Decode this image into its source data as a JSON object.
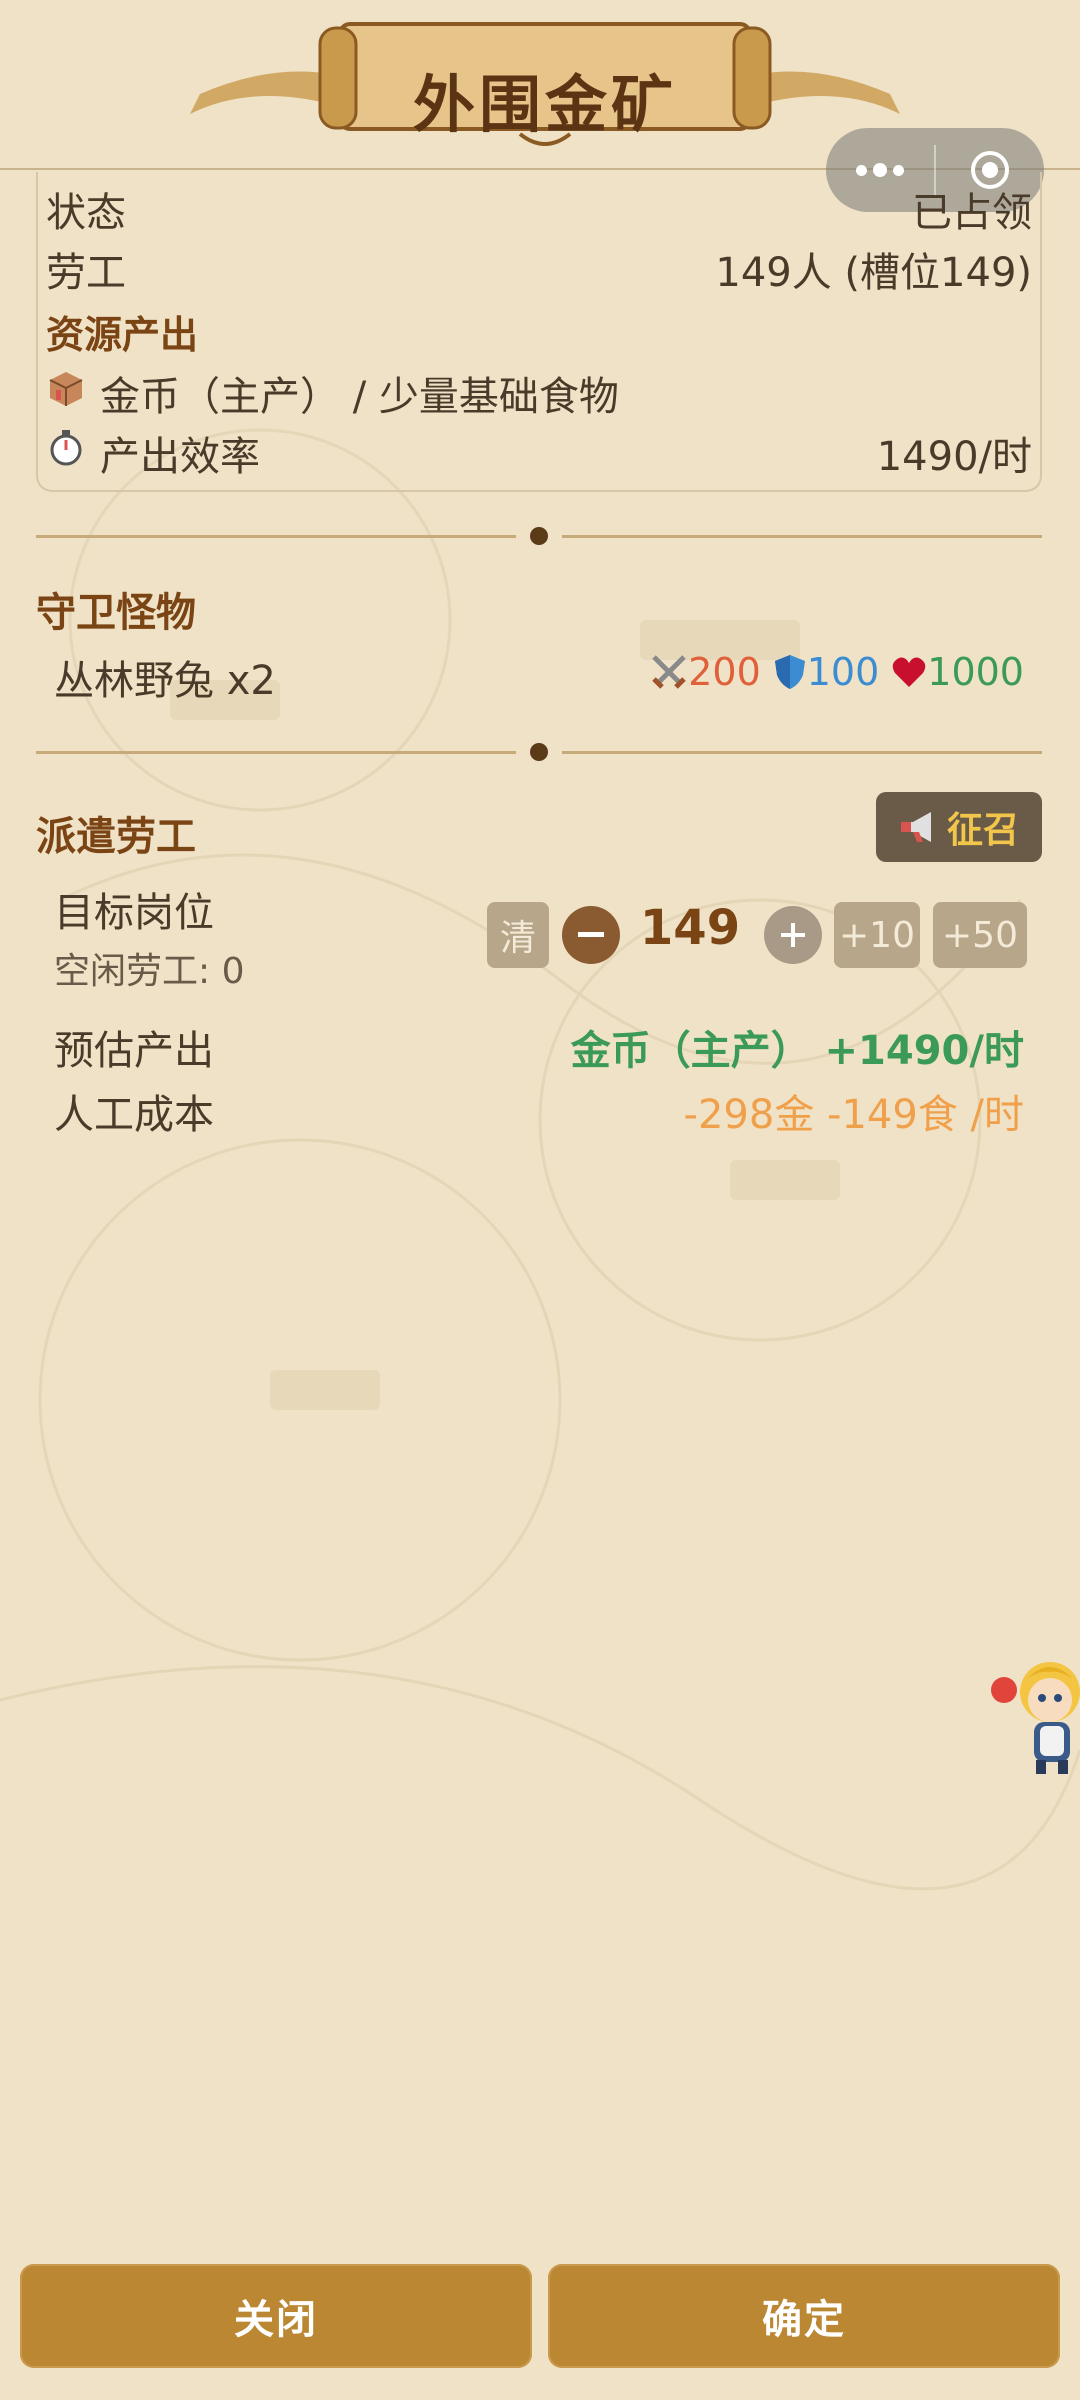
{
  "title": "外围金矿",
  "info": {
    "status_label": "状态",
    "status_value": "已占领",
    "workers_label": "劳工",
    "workers_value": "149人 (槽位149)",
    "resource_title": "资源产出",
    "resource_desc": "金币（主产） / 少量基础食物",
    "efficiency_label": "产出效率",
    "efficiency_value": "1490/时"
  },
  "guard": {
    "title": "守卫怪物",
    "monster": "丛林野兔 x2",
    "attack": "200",
    "defense": "100",
    "hp": "1000"
  },
  "dispatch": {
    "title": "派遣劳工",
    "recruit_label": "征召",
    "target_label": "目标岗位",
    "idle_label": "空闲劳工: 0",
    "clear_label": "清",
    "count": "149",
    "plus10": "+10",
    "plus50": "+50",
    "estimate_label": "预估产出",
    "estimate_value": "金币（主产） +1490/时",
    "cost_label": "人工成本",
    "cost_value": "-298金 -149食 /时"
  },
  "buttons": {
    "close": "关闭",
    "confirm": "确定"
  },
  "colors": {
    "background": "#efe2c6",
    "accent_brown": "#7a4414",
    "button_gold": "#bb8733",
    "estimate_green": "#3c9a58",
    "cost_orange": "#f0a04a"
  }
}
